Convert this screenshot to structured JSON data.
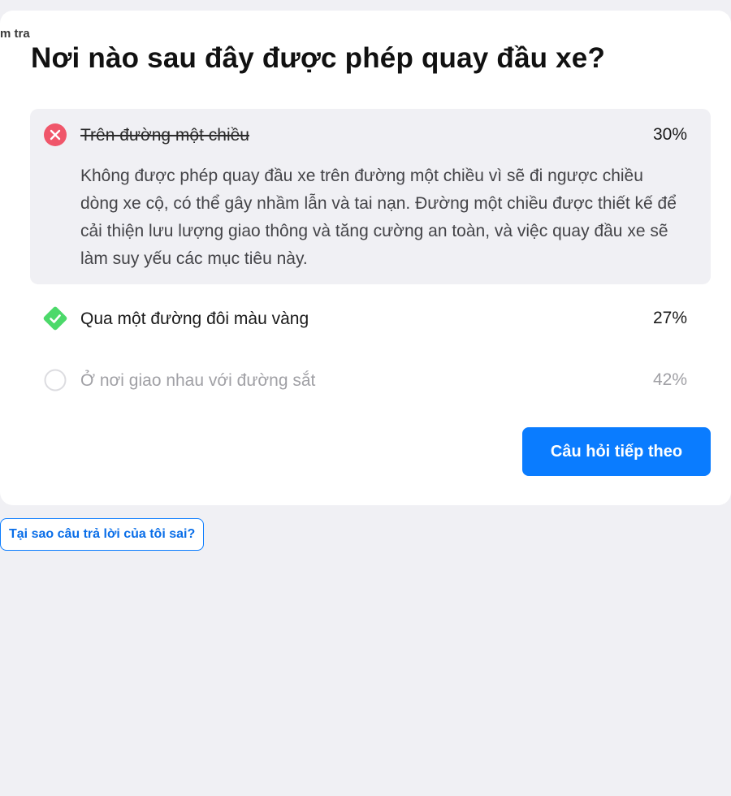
{
  "breadcrumb": "m tra",
  "question": "Nơi nào sau đây được phép quay đầu xe?",
  "options": [
    {
      "label": "Trên đường một chiều",
      "percent": "30%",
      "status": "wrong",
      "icon": "x-circle-icon",
      "explanation": "Không được phép quay đầu xe trên đường một chiều vì sẽ đi ngược chiều dòng xe cộ, có thể gây nhầm lẫn và tai nạn. Đường một chiều được thiết kế để cải thiện lưu lượng giao thông và tăng cường an toàn, và việc quay đầu xe sẽ làm suy yếu các mục tiêu này."
    },
    {
      "label": "Qua một đường đôi màu vàng",
      "percent": "27%",
      "status": "correct",
      "icon": "check-diamond-icon"
    },
    {
      "label": "Ở nơi giao nhau với đường sắt",
      "percent": "42%",
      "status": "unselected",
      "icon": "empty-circle-icon"
    }
  ],
  "next_button": "Câu hỏi tiếp theo",
  "why_wrong_link": "Tại sao câu trả lời của tôi sai?",
  "colors": {
    "background": "#f0f0f4",
    "card": "#ffffff",
    "accent": "#0a7cff",
    "wrong": "#f0566a",
    "correct": "#4cd96a",
    "muted": "#a0a0a5"
  }
}
